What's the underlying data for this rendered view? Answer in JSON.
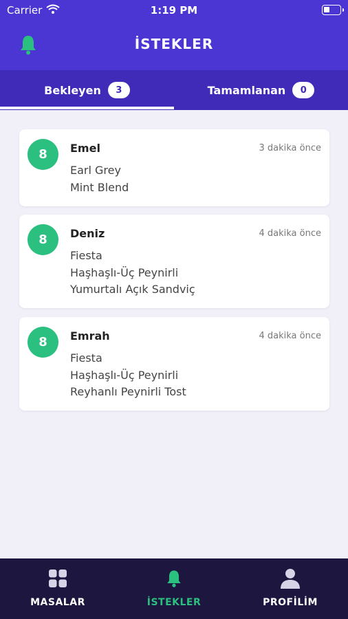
{
  "status": {
    "carrier": "Carrier",
    "time": "1:19 PM"
  },
  "header": {
    "title": "İSTEKLER"
  },
  "tabs": [
    {
      "label": "Bekleyen",
      "count": "3"
    },
    {
      "label": "Tamamlanan",
      "count": "0"
    }
  ],
  "requests": [
    {
      "avatar": "8",
      "name": "Emel",
      "time": "3 dakika önce",
      "items": [
        "Earl Grey",
        "Mint Blend"
      ]
    },
    {
      "avatar": "8",
      "name": "Deniz",
      "time": "4 dakika önce",
      "items": [
        "Fiesta",
        "Haşhaşlı-Üç Peynirli",
        "Yumurtalı Açık Sandviç"
      ]
    },
    {
      "avatar": "8",
      "name": "Emrah",
      "time": "4 dakika önce",
      "items": [
        "Fiesta",
        "Haşhaşlı-Üç Peynirli",
        "Reyhanlı Peynirli Tost"
      ]
    }
  ],
  "nav": [
    {
      "label": "MASALAR",
      "icon": "grid-icon"
    },
    {
      "label": "İSTEKLER",
      "icon": "bell-icon"
    },
    {
      "label": "PROFİLİM",
      "icon": "user-icon"
    }
  ],
  "colors": {
    "header": "#4b35d3",
    "tabs": "#3f2bb8",
    "accent": "#2bbf80",
    "tabbar": "#1d163f"
  }
}
